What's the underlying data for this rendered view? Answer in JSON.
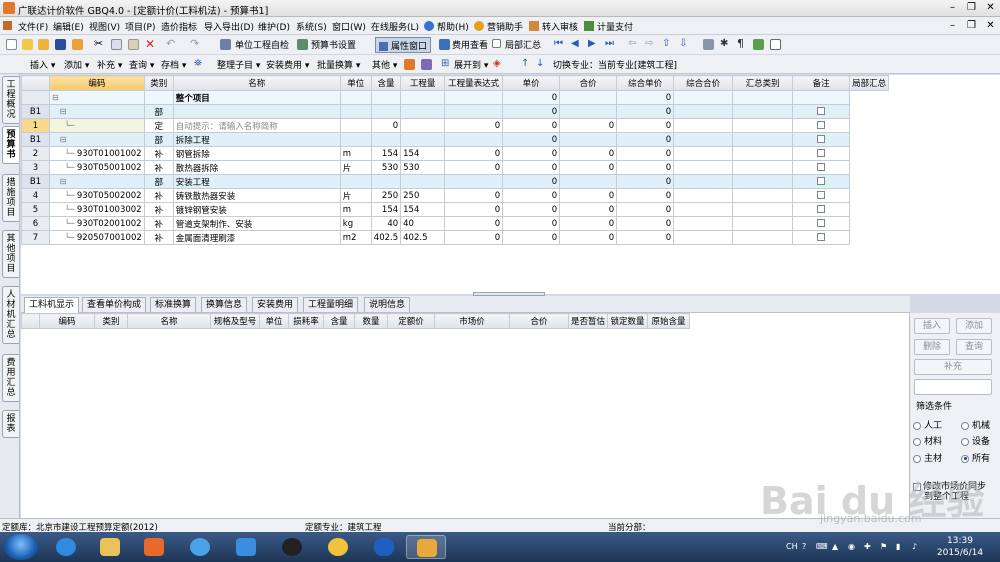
{
  "window": {
    "title": "广联达计价软件 GBQ4.0 - [定额计价(工料机法) - 预算书1]"
  },
  "menu": [
    "文件(F)",
    "编辑(E)",
    "视图(V)",
    "项目(P)",
    "造价指标",
    "导入导出(D)",
    "维护(D)",
    "系统(S)",
    "窗口(W)",
    "在线服务(L)",
    "帮助(H)",
    "营销助手",
    "转入审核",
    "计量支付"
  ],
  "toolbar1": {
    "check": "单位工程自检",
    "settings": "预算书设置",
    "property_window": "属性窗口",
    "cost_view": "费用查看",
    "partial_summary": "局部汇总"
  },
  "toolbar2": {
    "insert": "插入",
    "add": "添加",
    "supplement": "补充",
    "query": "查询",
    "price": "存档",
    "organize": "整理子目",
    "install_cost": "安装费用",
    "batch_convert": "批量换算",
    "other": "其他",
    "expand": "展开到",
    "switch_specialty": "切换专业：当前专业[建筑工程]"
  },
  "left_tabs": [
    "工程概况",
    "预算书",
    "措施项目",
    "其他项目",
    "人材机汇总",
    "费用汇总",
    "报表"
  ],
  "grid": {
    "columns": [
      "编码",
      "类别",
      "名称",
      "单位",
      "含量",
      "工程量",
      "工程量表达式",
      "单价",
      "合价",
      "综合单价",
      "综合合价",
      "汇总类别",
      "备注",
      "局部汇总"
    ],
    "rows": [
      {
        "rowhdr": "",
        "code": "",
        "type": "",
        "name": "整个项目",
        "unit": "",
        "qty": "",
        "expr": "",
        "price": "",
        "total": "0",
        "cprice": "",
        "ctotal": "0",
        "cat": "",
        "note": "",
        "style": "top",
        "check": false
      },
      {
        "rowhdr": "B1",
        "code": "",
        "type": "部",
        "name": "",
        "unit": "",
        "qty": "",
        "expr": "",
        "price": "",
        "total": "0",
        "cprice": "",
        "ctotal": "0",
        "cat": "",
        "note": "",
        "style": "group",
        "check": true
      },
      {
        "rowhdr": "1",
        "code": "",
        "type": "定",
        "name": "自动提示：请输入名称简称",
        "unit": "",
        "qty": "0",
        "expr": "",
        "price": "0",
        "total": "0",
        "cprice": "0",
        "ctotal": "0",
        "cat": "",
        "note": "",
        "style": "active",
        "check": true
      },
      {
        "rowhdr": "B1",
        "code": "",
        "type": "部",
        "name": "拆除工程",
        "unit": "",
        "qty": "",
        "expr": "",
        "price": "",
        "total": "0",
        "cprice": "",
        "ctotal": "0",
        "cat": "",
        "note": "",
        "style": "group",
        "check": true
      },
      {
        "rowhdr": "2",
        "code": "930T01001002",
        "type": "补",
        "name": "钢管拆除",
        "unit": "m",
        "qty": "154",
        "expr": "154",
        "price": "0",
        "total": "0",
        "cprice": "0",
        "ctotal": "0",
        "cat": "",
        "note": "",
        "style": "",
        "check": true
      },
      {
        "rowhdr": "3",
        "code": "930T05001002",
        "type": "补",
        "name": "散热器拆除",
        "unit": "片",
        "qty": "530",
        "expr": "530",
        "price": "0",
        "total": "0",
        "cprice": "0",
        "ctotal": "0",
        "cat": "",
        "note": "",
        "style": "",
        "check": true
      },
      {
        "rowhdr": "B1",
        "code": "",
        "type": "部",
        "name": "安装工程",
        "unit": "",
        "qty": "",
        "expr": "",
        "price": "",
        "total": "0",
        "cprice": "",
        "ctotal": "0",
        "cat": "",
        "note": "",
        "style": "group",
        "check": true
      },
      {
        "rowhdr": "4",
        "code": "930T05002002",
        "type": "补",
        "name": "铸铁散热器安装",
        "unit": "片",
        "qty": "250",
        "expr": "250",
        "price": "0",
        "total": "0",
        "cprice": "0",
        "ctotal": "0",
        "cat": "",
        "note": "",
        "style": "",
        "check": true
      },
      {
        "rowhdr": "5",
        "code": "930T01003002",
        "type": "补",
        "name": "镀锌钢管安装",
        "unit": "m",
        "qty": "154",
        "expr": "154",
        "price": "0",
        "total": "0",
        "cprice": "0",
        "ctotal": "0",
        "cat": "",
        "note": "",
        "style": "",
        "check": true
      },
      {
        "rowhdr": "6",
        "code": "930T02001002",
        "type": "补",
        "name": "管道支架制作、安装",
        "unit": "kg",
        "qty": "40",
        "expr": "40",
        "price": "0",
        "total": "0",
        "cprice": "0",
        "ctotal": "0",
        "cat": "",
        "note": "",
        "style": "",
        "check": true
      },
      {
        "rowhdr": "7",
        "code": "920507001002",
        "type": "补",
        "name": "金属面清理刷漆",
        "unit": "m2",
        "qty": "402.5",
        "expr": "402.5",
        "price": "0",
        "total": "0",
        "cprice": "0",
        "ctotal": "0",
        "cat": "",
        "note": "",
        "style": "",
        "check": true
      }
    ]
  },
  "bottom_tabs": [
    "工料机显示",
    "查看单价构成",
    "标准换算",
    "换算信息",
    "安装费用",
    "工程量明细",
    "说明信息"
  ],
  "bottom_grid": {
    "columns": [
      "编码",
      "类别",
      "名称",
      "规格及型号",
      "单位",
      "损耗率",
      "含量",
      "数量",
      "定额价",
      "市场价",
      "合价",
      "是否暂估",
      "锁定数量",
      "原始含量"
    ]
  },
  "right_panel": {
    "insert": "插入",
    "add": "添加",
    "delete": "删除",
    "query": "查询",
    "supplement": "补充",
    "filter_title": "筛选条件",
    "options": [
      "人工",
      "机械",
      "材料",
      "设备",
      "主材",
      "所有"
    ],
    "selected": "所有",
    "sync_text_1": "修改市场价同步",
    "sync_text_2": "到整个工程"
  },
  "status": {
    "quota_lib": "定额库：北京市建设工程预算定额(2012)",
    "specialty": "定额专业：建筑工程",
    "current_part": "当前分部："
  },
  "taskbar": {
    "ime": "CH",
    "time": "13:39",
    "date": "2015/6/14"
  },
  "watermark": {
    "brand": "Bai du 经验",
    "url": "jingyan.baidu.com"
  }
}
